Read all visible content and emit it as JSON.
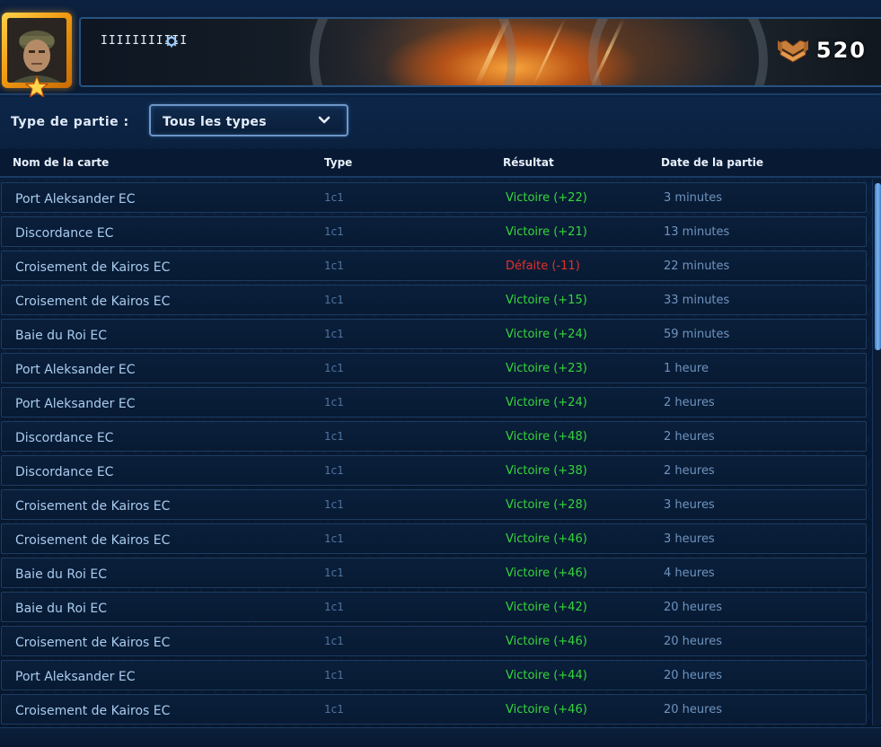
{
  "header": {
    "player_name": "IIIIIIIIIII",
    "points": "520",
    "icons": {
      "portrait": "soldier-portrait-icon",
      "rank": "rank-star-icon",
      "settings": "gear-icon",
      "points": "winged-chevron-emblem-icon"
    },
    "accent_colors": {
      "portrait_frame": "#f5a623",
      "banner_glow": "#ff9a2a"
    }
  },
  "filter": {
    "label": "Type de partie :",
    "selected": "Tous les types",
    "icon": "chevron-down-icon"
  },
  "table": {
    "columns": [
      "Nom de la carte",
      "Type",
      "Résultat",
      "Date de la partie"
    ],
    "rows": [
      {
        "map": "Port Aleksander EC",
        "type": "1c1",
        "result": "Victoire (+22)",
        "outcome": "win",
        "date": "3 minutes"
      },
      {
        "map": "Discordance EC",
        "type": "1c1",
        "result": "Victoire (+21)",
        "outcome": "win",
        "date": "13 minutes"
      },
      {
        "map": "Croisement de Kairos EC",
        "type": "1c1",
        "result": "Défaite (-11)",
        "outcome": "loss",
        "date": "22 minutes"
      },
      {
        "map": "Croisement de Kairos EC",
        "type": "1c1",
        "result": "Victoire (+15)",
        "outcome": "win",
        "date": "33 minutes"
      },
      {
        "map": "Baie du Roi EC",
        "type": "1c1",
        "result": "Victoire (+24)",
        "outcome": "win",
        "date": "59 minutes"
      },
      {
        "map": "Port Aleksander EC",
        "type": "1c1",
        "result": "Victoire (+23)",
        "outcome": "win",
        "date": "1 heure"
      },
      {
        "map": "Port Aleksander EC",
        "type": "1c1",
        "result": "Victoire (+24)",
        "outcome": "win",
        "date": "2 heures"
      },
      {
        "map": "Discordance EC",
        "type": "1c1",
        "result": "Victoire (+48)",
        "outcome": "win",
        "date": "2 heures"
      },
      {
        "map": "Discordance EC",
        "type": "1c1",
        "result": "Victoire (+38)",
        "outcome": "win",
        "date": "2 heures"
      },
      {
        "map": "Croisement de Kairos EC",
        "type": "1c1",
        "result": "Victoire (+28)",
        "outcome": "win",
        "date": "3 heures"
      },
      {
        "map": "Croisement de Kairos EC",
        "type": "1c1",
        "result": "Victoire (+46)",
        "outcome": "win",
        "date": "3 heures"
      },
      {
        "map": "Baie du Roi EC",
        "type": "1c1",
        "result": "Victoire (+46)",
        "outcome": "win",
        "date": "4 heures"
      },
      {
        "map": "Baie du Roi EC",
        "type": "1c1",
        "result": "Victoire (+42)",
        "outcome": "win",
        "date": "20 heures"
      },
      {
        "map": "Croisement de Kairos EC",
        "type": "1c1",
        "result": "Victoire (+46)",
        "outcome": "win",
        "date": "20 heures"
      },
      {
        "map": "Port Aleksander EC",
        "type": "1c1",
        "result": "Victoire (+44)",
        "outcome": "win",
        "date": "20 heures"
      },
      {
        "map": "Croisement de Kairos EC",
        "type": "1c1",
        "result": "Victoire (+46)",
        "outcome": "win",
        "date": "20 heures"
      }
    ],
    "colors": {
      "win": "#35d63a",
      "loss": "#e4302a",
      "map_text": "#a9ccef",
      "date_text": "#6f94bf"
    }
  }
}
